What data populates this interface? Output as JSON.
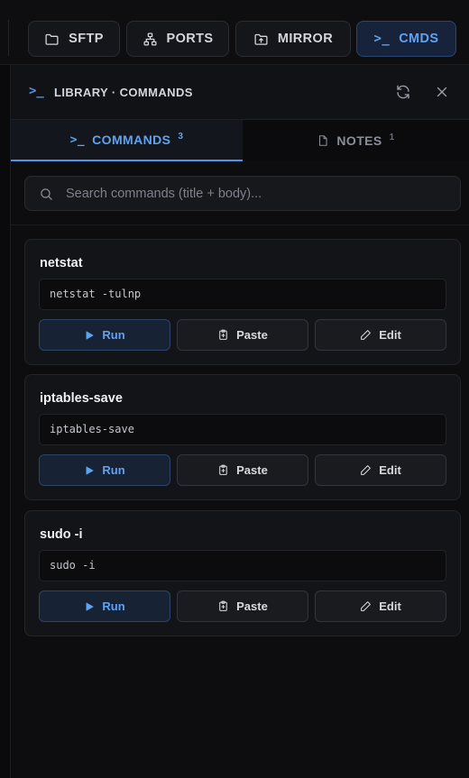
{
  "toolbar": {
    "sftp": "SFTP",
    "ports": "PORTS",
    "mirror": "MIRROR",
    "cmds": "CMDS",
    "cmds_glyph": ">_"
  },
  "panel": {
    "glyph": ">_",
    "title": "LIBRARY · COMMANDS",
    "refresh_icon": "refresh-icon",
    "close_icon": "close-icon"
  },
  "tabs": [
    {
      "label": "COMMANDS",
      "count": "3",
      "glyph": ">_",
      "active": true
    },
    {
      "label": "NOTES",
      "count": "1",
      "active": false
    }
  ],
  "search": {
    "placeholder": "Search commands (title + body)...",
    "value": ""
  },
  "commands": [
    {
      "title": "netstat",
      "command": "netstat -tulnp"
    },
    {
      "title": "iptables-save",
      "command": "iptables-save"
    },
    {
      "title": "sudo -i",
      "command": "sudo -i"
    }
  ],
  "actions": {
    "run": "Run",
    "paste": "Paste",
    "edit": "Edit"
  },
  "colors": {
    "accent": "#5ea3f2",
    "background": "#0d0d10",
    "card": "#131418"
  }
}
